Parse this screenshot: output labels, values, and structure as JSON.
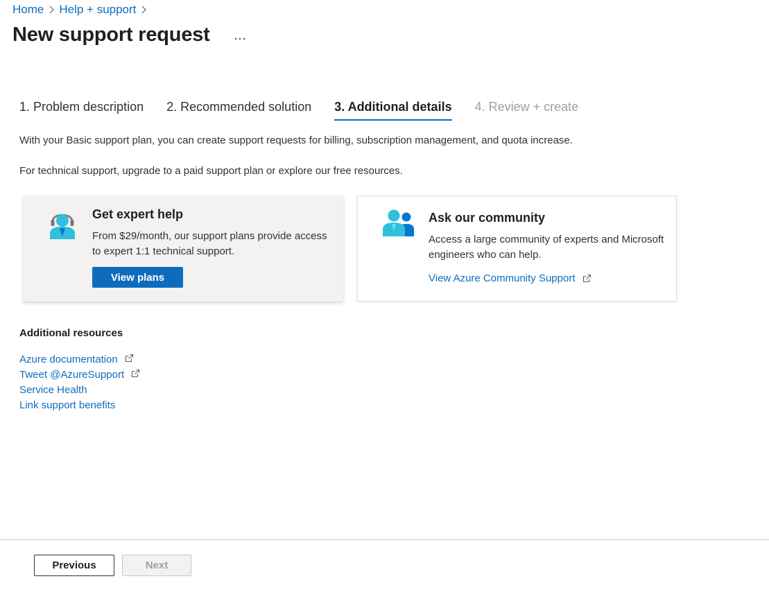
{
  "breadcrumb": {
    "items": [
      "Home",
      "Help + support"
    ]
  },
  "header": {
    "title": "New support request",
    "more_label": "..."
  },
  "wizard": {
    "tabs": [
      {
        "label": "1. Problem description",
        "state": "complete"
      },
      {
        "label": "2. Recommended solution",
        "state": "complete"
      },
      {
        "label": "3. Additional details",
        "state": "active"
      },
      {
        "label": "4. Review + create",
        "state": "disabled"
      }
    ]
  },
  "info": {
    "plan_text": "With your Basic support plan, you can create support requests for billing, subscription management, and quota increase.",
    "technical_text": "For technical support, upgrade to a paid support plan or explore our free resources."
  },
  "cards": {
    "expert": {
      "icon": "support-agent-icon",
      "title": "Get expert help",
      "text": "From $29/month, our support plans provide access to expert 1:1 technical support.",
      "button_label": "View plans"
    },
    "community": {
      "icon": "community-users-icon",
      "title": "Ask our community",
      "text": "Access a large community of experts and Microsoft engineers who can help.",
      "link_label": "View Azure Community Support"
    }
  },
  "resources": {
    "heading": "Additional resources",
    "links": [
      {
        "label": "Azure documentation",
        "external": true
      },
      {
        "label": "Tweet @AzureSupport",
        "external": true
      },
      {
        "label": "Service Health",
        "external": false
      },
      {
        "label": "Link support benefits",
        "external": false
      }
    ]
  },
  "footer": {
    "previous_label": "Previous",
    "next_label": "Next"
  },
  "colors": {
    "accent": "#0f6cbd",
    "text": "#323130",
    "disabled_text": "#a19f9d",
    "card_background": "#f3f2f1",
    "icon_cyan": "#32bedd",
    "icon_blue": "#0078d4"
  }
}
